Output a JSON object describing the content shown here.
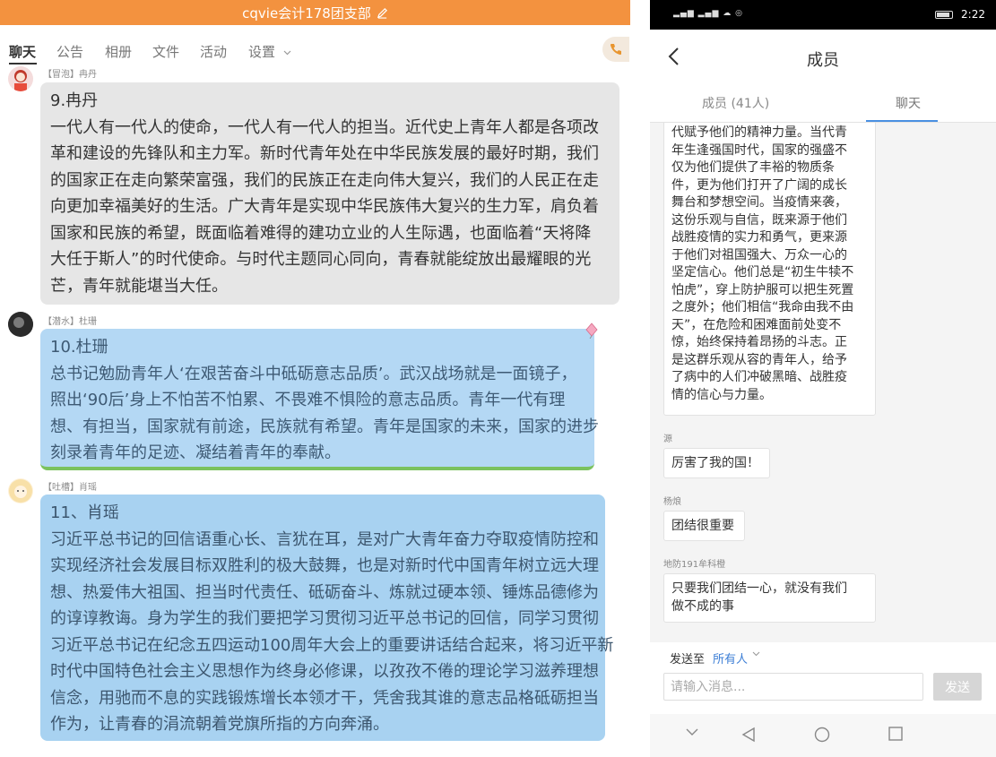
{
  "left": {
    "header": {
      "title": "cqvie会计178团支部"
    },
    "tabs": [
      "聊天",
      "公告",
      "相册",
      "文件",
      "活动",
      "设置"
    ],
    "messages": [
      {
        "meta": "【冒泡】冉丹",
        "title": "9.冉丹",
        "lines": [
          "一代人有一代人的使命，一代人有一代人的担当。近代史上青年人都是各项改",
          "革和建设的先锋队和主力军。新时代青年处在中华民族发展的最好时期，我们",
          "的国家正在走向繁荣富强，我们的民族正在走向伟大复兴，我们的人民正在走",
          "向更加幸福美好的生活。广大青年是实现中华民族伟大复兴的生力军，肩负着",
          "国家和民族的希望，既面临着难得的建功立业的人生际遇，也面临着“天将降",
          "大任于斯人”的时代使命。与时代主题同心同向，青春就能绽放出最耀眼的光",
          "芒，青年就能堪当大任。"
        ]
      },
      {
        "meta": "【潜水】杜珊",
        "title": "10.杜珊",
        "lines": [
          "总书记勉励青年人‘在艰苦奋斗中砥砺意志品质’。武汉战场就是一面镜子，",
          "照出‘90后’身上不怕苦不怕累、不畏难不惧险的意志品质。青年一代有理",
          "想、有担当，国家就有前途，民族就有希望。青年是国家的未来，国家的进步",
          "刻录着青年的足迹、凝结着青年的奉献。"
        ]
      },
      {
        "meta": "【吐槽】肖瑶",
        "title": "11、肖瑶",
        "lines": [
          "习近平总书记的回信语重心长、言犹在耳，是对广大青年奋力夺取疫情防控和",
          "实现经济社会发展目标双胜利的极大鼓舞，也是对新时代中国青年树立远大理",
          "想、热爱伟大祖国、担当时代责任、砥砺奋斗、炼就过硬本领、锤炼品德修为",
          "的谆谆教诲。身为学生的我们要把学习贯彻习近平总书记的回信，同学习贯彻",
          "习近平总书记在纪念五四运动100周年大会上的重要讲话结合起来，将习近平新",
          "时代中国特色社会主义思想作为终身必修课，以孜孜不倦的理论学习滋养理想",
          "信念，用驰而不息的实践锻炼增长本领才干，凭舍我其谁的意志品格砥砺担当",
          "作为，让青春的涓流朝着党旗所指的方向奔涌。"
        ]
      }
    ]
  },
  "right": {
    "status": {
      "time": "2:22"
    },
    "nav": {
      "title": "成员"
    },
    "segments": {
      "members": "成员 (41人)",
      "chat": "聊天"
    },
    "messages": [
      {
        "sender": "",
        "lines": [
          "代赋予他们的精神力量。当代青",
          "年生逢强国时代，国家的强盛不",
          "仅为他们提供了丰裕的物质条",
          "件，更为他们打开了广阔的成长",
          "舞台和梦想空间。当疫情来袭，",
          "这份乐观与自信，既来源于他们",
          "战胜疫情的实力和勇气，更来源",
          "于他们对祖国强大、万众一心的",
          "坚定信心。他们总是“初生牛犊不",
          "怕虎”，穿上防护服可以把生死置",
          "之度外；他们相信“我命由我不由",
          "天”，在危险和困难面前处变不",
          "惊，始终保持着昂扬的斗志。正",
          "是这群乐观从容的青年人，给予",
          "了病中的人们冲破黑暗、战胜疫",
          "情的信心与力量。"
        ]
      },
      {
        "sender": "源",
        "lines": [
          "厉害了我的国！"
        ]
      },
      {
        "sender": "杨烺",
        "lines": [
          "团结很重要"
        ]
      },
      {
        "sender": "地防191牟科橙",
        "lines": [
          "只要我们团结一心，就没有我们",
          "做不成的事"
        ]
      }
    ],
    "compose": {
      "send_to_label": "发送至",
      "recipient": "所有人",
      "placeholder": "请输入消息...",
      "send_label": "发送"
    }
  }
}
